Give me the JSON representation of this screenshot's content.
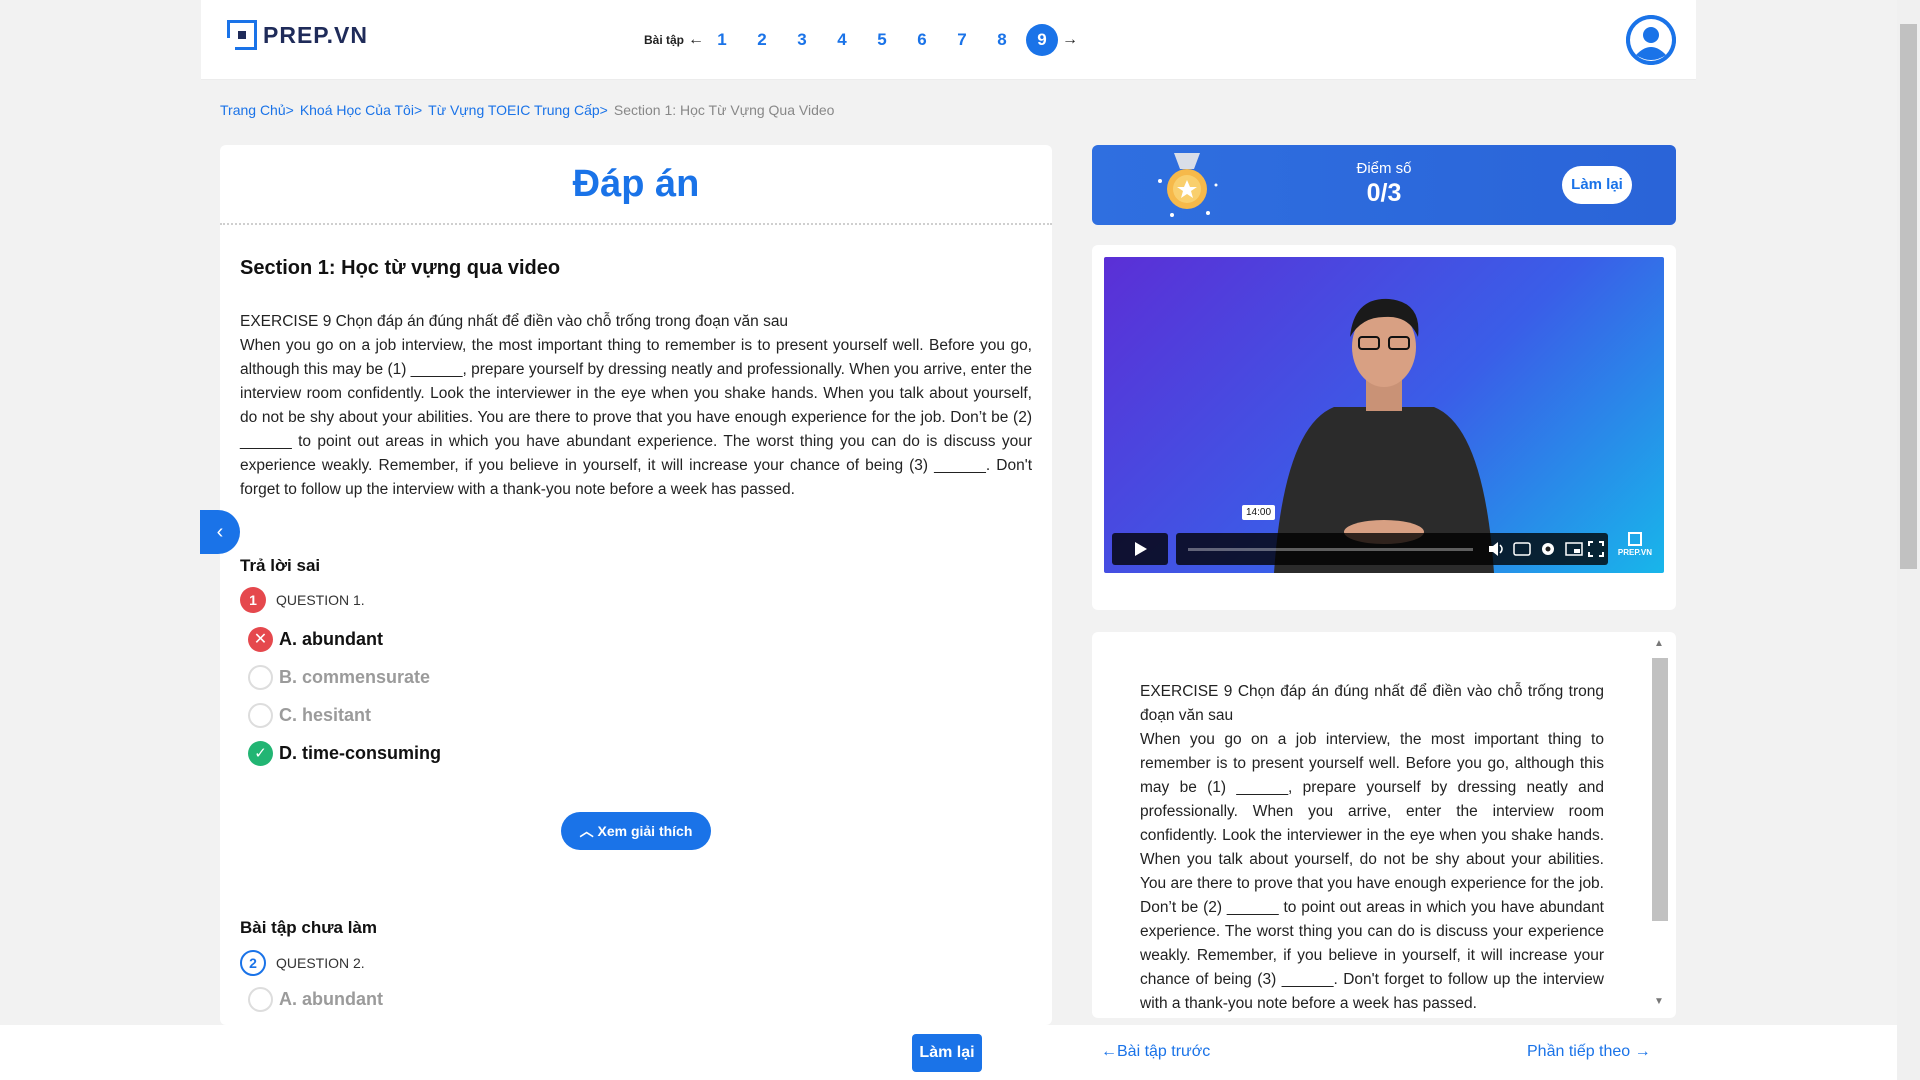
{
  "header": {
    "logo_text": "PREP.VN",
    "exercise_label": "Bài tập",
    "prev_arrow": "←",
    "next_arrow": "→",
    "exercises": [
      "1",
      "2",
      "3",
      "4",
      "5",
      "6",
      "7",
      "8",
      "9"
    ],
    "active_exercise": "9"
  },
  "breadcrumb": [
    {
      "label": "Trang Chủ",
      "sep": ">"
    },
    {
      "label": "Khoá Học Của Tôi",
      "sep": ">"
    },
    {
      "label": "Từ Vựng TOEIC Trung Cấp",
      "sep": ">"
    },
    {
      "label": "Section 1: Học Từ Vựng Qua Video",
      "sep": ""
    }
  ],
  "left": {
    "title": "Đáp án",
    "section_title": "Section 1: Học từ vựng qua video",
    "exercise_heading": "EXERCISE 9 Chọn đáp án đúng nhất để điền vào chỗ trống trong đoạn văn sau",
    "passage": "When you go on a job interview, the most important thing to remember is to present yourself well. Before you go,  although this may be (1) ______, prepare yourself by dressing neatly and professionally. When you arrive, enter the interview room confidently. Look the interviewer in the eye when you shake hands. When you talk about yourself, do not be shy about your abilities. You are there to prove that you have enough experience for the job. Don’t be (2) ______ to point out areas in which you have abundant experience. The worst thing you can do is discuss your experience weakly. Remember, if you believe in yourself, it will increase your chance of being (3) ______. Don't forget to follow up the interview with a thank-you note before a week has passed.",
    "wrong_group_title": "Trả lời sai",
    "q1": {
      "number": "1",
      "label": "QUESTION 1.",
      "options": [
        "A. abundant",
        "B. commensurate",
        "C. hesitant",
        "D. time-consuming"
      ]
    },
    "explain_button": "Xem giải thích",
    "todo_group_title": "Bài tập chưa làm",
    "q2": {
      "number": "2",
      "label": "QUESTION 2.",
      "options": [
        "A. abundant"
      ]
    }
  },
  "score": {
    "label": "Điểm số",
    "value": "0/3",
    "retry": "Làm lại"
  },
  "video": {
    "time_tooltip": "14:00",
    "brand": "PREP.VN"
  },
  "right_text": {
    "exercise_heading": "EXERCISE 9 Chọn đáp án đúng nhất để điền vào chỗ trống trong đoạn văn sau",
    "passage": "When you go on a job interview, the most important thing to remember is to present yourself well. Before you go, although this may be (1) ______, prepare yourself by dressing neatly and professionally. When you arrive, enter the interview room confidently. Look the interviewer in the eye when you shake hands. When you talk about yourself, do not be shy about your abilities. You are there to prove that you have enough experience for the job. Don’t be (2) ______ to point out areas in which you have abundant experience. The worst thing you can do is discuss your experience weakly. Remember, if you believe in yourself, it will increase your chance of being (3) ______. Don't forget to follow up the interview with a thank-you note before a week has passed."
  },
  "footer": {
    "retry": "Làm lại",
    "prev": "←Bài tập trước",
    "next": "Phần tiếp theo"
  },
  "colors": {
    "accent": "#1a73e8",
    "wrong": "#e5484d",
    "correct": "#22b573"
  }
}
